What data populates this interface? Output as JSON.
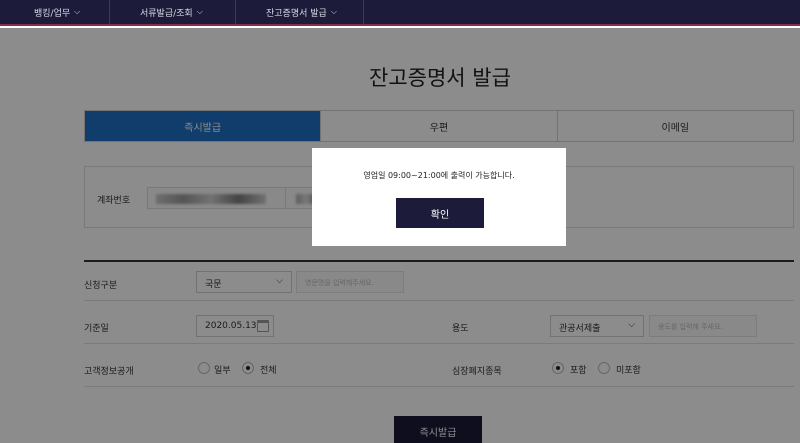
{
  "nav": {
    "items": [
      {
        "label": "뱅킹/업무"
      },
      {
        "label": "서류발급/조회"
      },
      {
        "label": "잔고증명서 발급"
      }
    ]
  },
  "page": {
    "title": "잔고증명서 발급"
  },
  "tabs": [
    {
      "label": "즉시발급",
      "active": true
    },
    {
      "label": "우편",
      "active": false
    },
    {
      "label": "이메일",
      "active": false
    }
  ],
  "account": {
    "label": "계좌번호"
  },
  "form": {
    "request_type": {
      "label": "신청구분",
      "selected": "국문",
      "name_placeholder": "영문명을 입력해주세요."
    },
    "base_date": {
      "label": "기준일",
      "value": "2020.05.13"
    },
    "purpose": {
      "label": "용도",
      "selected": "관공서제출",
      "placeholder": "용도를 입력해 주세요."
    },
    "customer_info": {
      "label": "고객정보공개",
      "options": [
        {
          "label": "일부",
          "checked": false
        },
        {
          "label": "전체",
          "checked": true
        }
      ]
    },
    "closed_accounts": {
      "label": "심장폐지종목",
      "options": [
        {
          "label": "포함",
          "checked": true
        },
        {
          "label": "미포함",
          "checked": false
        }
      ]
    }
  },
  "issue_button": {
    "label": "즉시발급"
  },
  "modal": {
    "message": "영업일 09:00~21:00에 출력이 가능합니다.",
    "confirm_label": "확인"
  },
  "colors": {
    "nav_bg": "#1c1b3a",
    "tab_active": "#1f6fc6",
    "button_bg": "#1c1b3a"
  }
}
